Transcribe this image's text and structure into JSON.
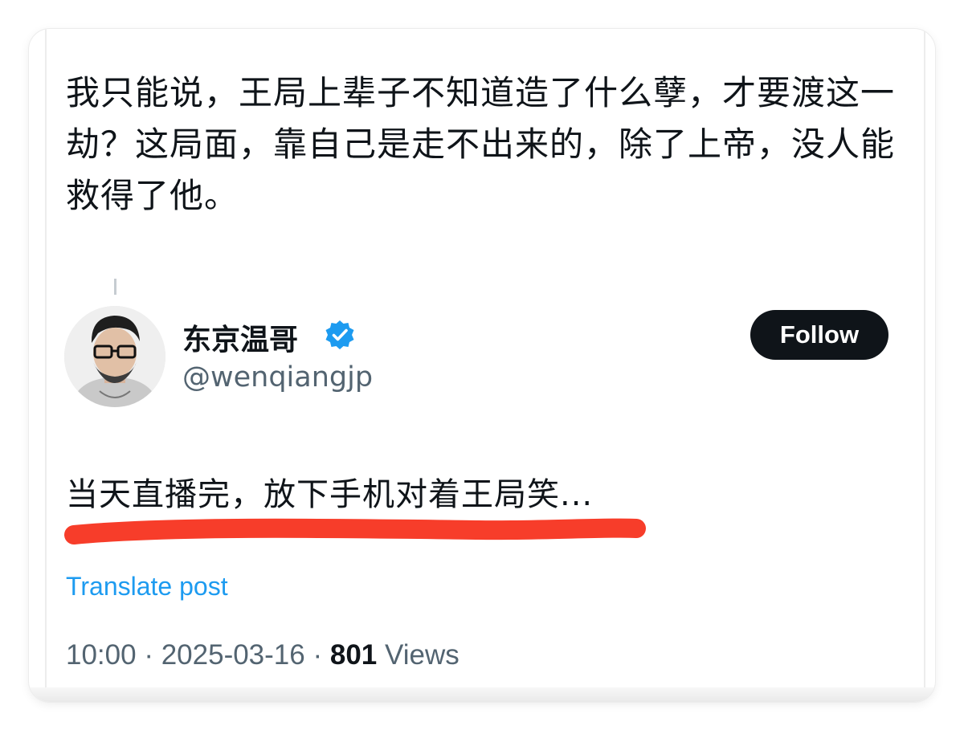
{
  "quote": {
    "text": "我只能说，王局上辈子不知道造了什么孽，才要渡这一劫？这局面，靠自己是走不出来的，除了上帝，没人能救得了他。"
  },
  "post": {
    "author_name": "东京温哥",
    "author_handle": "@wenqiangjp",
    "verified": true,
    "follow_label": "Follow",
    "text": "当天直播完，放下手机对着王局笑...",
    "translate_label": "Translate post",
    "time": "10:00",
    "separator": " · ",
    "date": "2025-03-16",
    "views_count": "801",
    "views_label": " Views"
  },
  "colors": {
    "follow_button_bg": "#0f1419",
    "verified_badge": "#1d9bf0",
    "link": "#1d9bf0",
    "highlight_underline": "#f73d2a"
  }
}
